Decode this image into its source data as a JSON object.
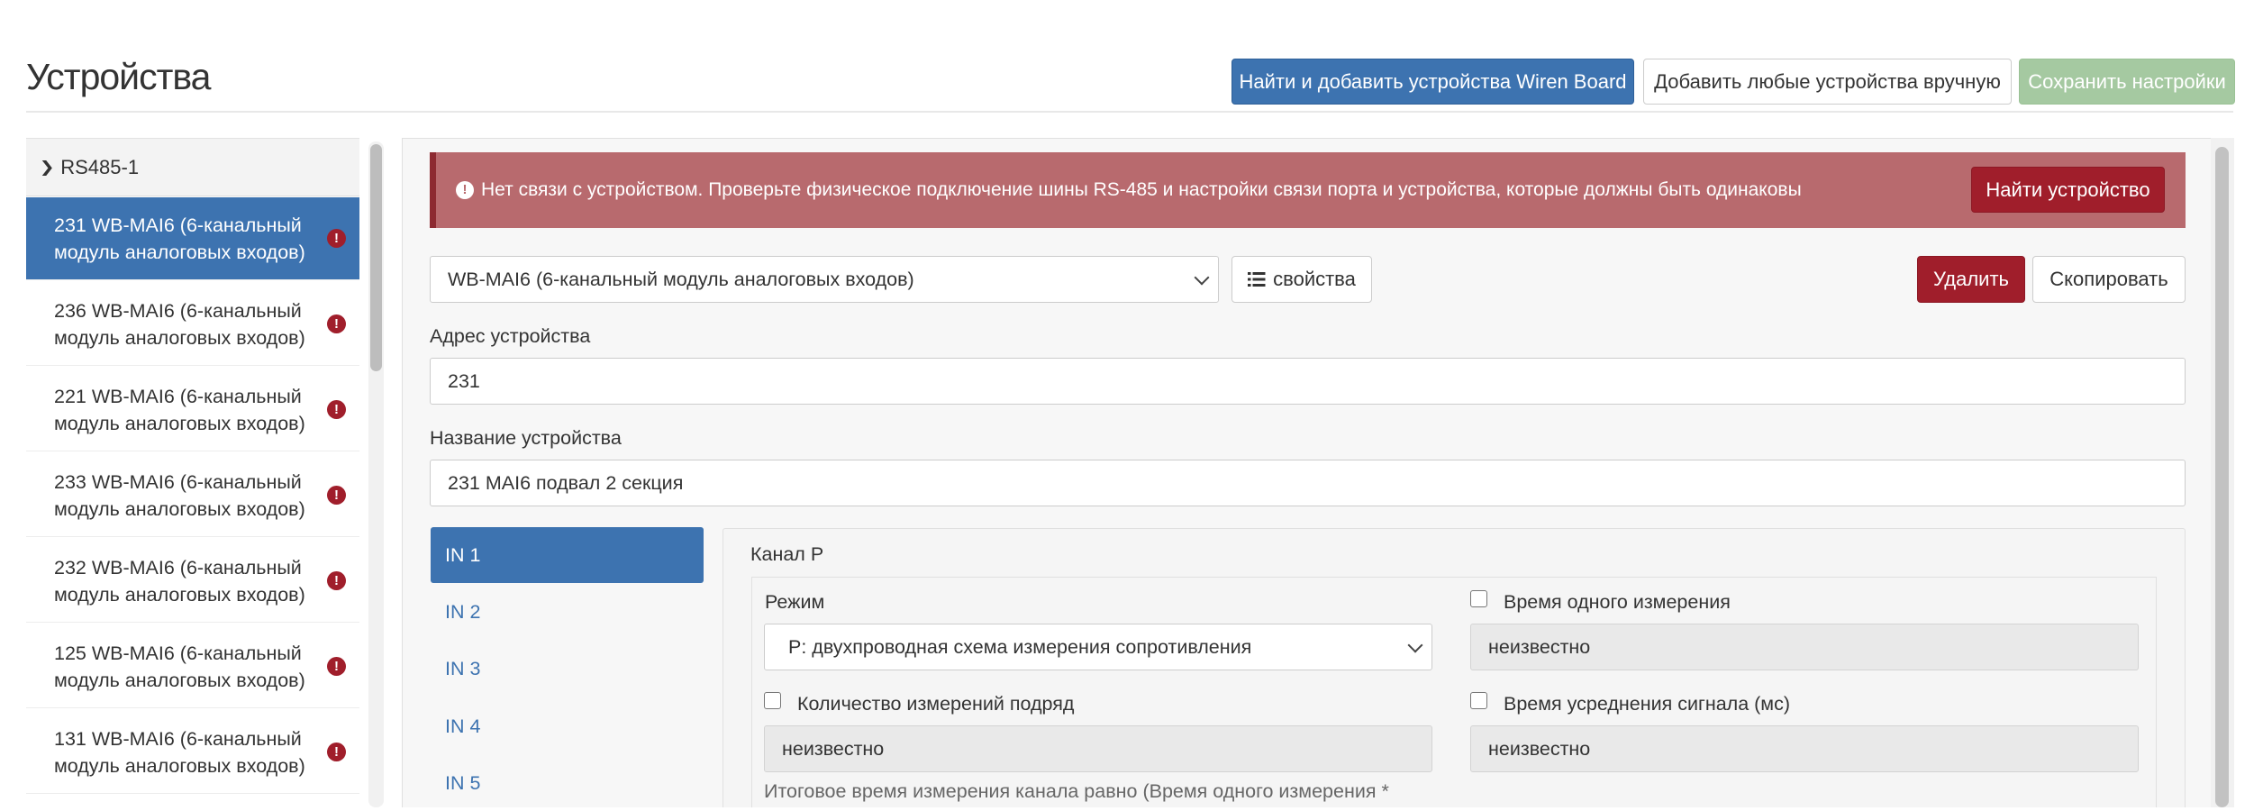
{
  "header": {
    "title": "Устройства",
    "find_add_button": "Найти и добавить устройства Wiren Board",
    "add_manual_button": "Добавить любые устройства вручную",
    "save_button": "Сохранить настройки"
  },
  "sidebar": {
    "port_label": "RS485-1",
    "devices": [
      {
        "line1": "231 WB-MAI6 (6-канальный",
        "line2": "модуль аналоговых входов)",
        "error": true,
        "active": true
      },
      {
        "line1": "236 WB-MAI6 (6-канальный",
        "line2": "модуль аналоговых входов)",
        "error": true,
        "active": false
      },
      {
        "line1": "221 WB-MAI6 (6-канальный",
        "line2": "модуль аналоговых входов)",
        "error": true,
        "active": false
      },
      {
        "line1": "233 WB-MAI6 (6-канальный",
        "line2": "модуль аналоговых входов)",
        "error": true,
        "active": false
      },
      {
        "line1": "232 WB-MAI6 (6-канальный",
        "line2": "модуль аналоговых входов)",
        "error": true,
        "active": false
      },
      {
        "line1": "125 WB-MAI6 (6-канальный",
        "line2": "модуль аналоговых входов)",
        "error": true,
        "active": false
      },
      {
        "line1": "131 WB-MAI6 (6-канальный",
        "line2": "модуль аналоговых входов)",
        "error": true,
        "active": false
      }
    ]
  },
  "alert": {
    "text": "Нет связи с устройством. Проверьте физическое подключение шины RS-485 и настройки связи порта и устройства, которые должны быть одинаковы",
    "find_device_button": "Найти устройство"
  },
  "device": {
    "type_value": "WB-MAI6 (6-канальный модуль аналоговых входов)",
    "properties_button": "свойства",
    "delete_button": "Удалить",
    "copy_button": "Скопировать",
    "address_label": "Адрес устройства",
    "address_value": "231",
    "name_label": "Название устройства",
    "name_value": "231 MAI6 подвал 2 секция"
  },
  "channels": {
    "tabs": [
      "IN 1",
      "IN 2",
      "IN 3",
      "IN 4",
      "IN 5"
    ],
    "active_tab": "IN 1",
    "title": "Канал P",
    "mode_label": "Режим",
    "mode_value": "P: двухпроводная схема измерения сопротивления",
    "single_time_label": "Время одного измерения",
    "single_time_value": "неизвестно",
    "count_label": "Количество измерений подряд",
    "count_value": "неизвестно",
    "avg_time_label": "Время усреднения сигнала (мс)",
    "avg_time_value": "неизвестно",
    "help_text": "Итоговое время измерения канала равно (Время одного измерения *"
  },
  "colors": {
    "primary": "#3d73b0",
    "danger": "#a01e2b",
    "alert_bg": "#b86a6e",
    "success_disabled": "#a5c9a1"
  }
}
